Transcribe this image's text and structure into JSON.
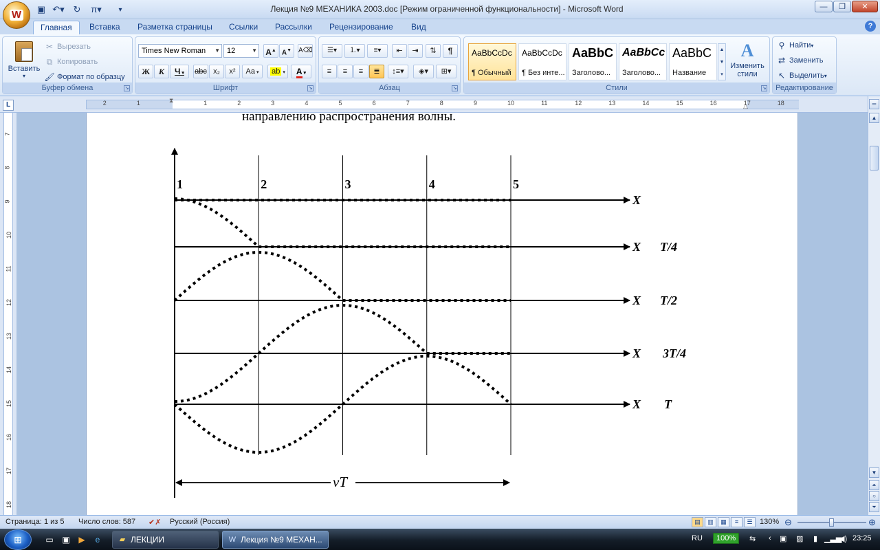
{
  "window": {
    "title": "Лекция №9 МЕХАНИКА 2003.doc [Режим ограниченной функциональности] - Microsoft Word",
    "office_button_letter": "W"
  },
  "tabs": [
    "Главная",
    "Вставка",
    "Разметка страницы",
    "Ссылки",
    "Рассылки",
    "Рецензирование",
    "Вид"
  ],
  "active_tab": "Главная",
  "ribbon": {
    "clipboard": {
      "label": "Буфер обмена",
      "paste": "Вставить",
      "cut": "Вырезать",
      "copy": "Копировать",
      "format_painter": "Формат по образцу"
    },
    "font": {
      "label": "Шрифт",
      "font_name": "Times New Roman",
      "font_size": "12",
      "bold": "Ж",
      "italic": "К",
      "underline": "Ч",
      "strike": "abc",
      "subscript": "x₂",
      "superscript": "x²",
      "change_case": "Aa",
      "grow": "A",
      "shrink": "A"
    },
    "paragraph": {
      "label": "Абзац"
    },
    "styles": {
      "label": "Стили",
      "items": [
        {
          "sample": "AaBbCcDc",
          "name": "¶ Обычный"
        },
        {
          "sample": "AaBbCcDc",
          "name": "¶ Без инте..."
        },
        {
          "sample": "AaBbC",
          "name": "Заголово..."
        },
        {
          "sample": "AaBbCc",
          "name": "Заголово..."
        },
        {
          "sample": "AaBbC",
          "name": "Название"
        }
      ],
      "selected_index": 0,
      "change_styles": "Изменить стили"
    },
    "editing": {
      "label": "Редактирование",
      "find": "Найти",
      "replace": "Заменить",
      "select": "Выделить"
    }
  },
  "ruler": {
    "h_left": [
      "2",
      "1"
    ],
    "h_right": [
      "1",
      "2",
      "3",
      "4",
      "5",
      "6",
      "7",
      "8",
      "9",
      "10",
      "11",
      "12",
      "13",
      "14",
      "15",
      "16",
      "17",
      "18"
    ],
    "v": [
      "7",
      "8",
      "9",
      "10",
      "11",
      "12",
      "13",
      "14",
      "15",
      "16",
      "17",
      "18"
    ]
  },
  "document": {
    "text_line": "направлению распространения волны.",
    "figure": {
      "column_labels": [
        "1",
        "2",
        "3",
        "4",
        "5"
      ],
      "row_axis_label": "X",
      "row_time_labels": [
        "",
        "T/4",
        "T/2",
        "3T/4",
        "T"
      ],
      "span_label": "vT"
    }
  },
  "status": {
    "page": "Страница: 1 из 5",
    "words": "Число слов: 587",
    "language": "Русский (Россия)",
    "zoom": "130%",
    "zoom_slider_level": 0.5
  },
  "taskbar": {
    "tasks": [
      {
        "label": "ЛЕКЦИИ",
        "active": false
      },
      {
        "label": "Лекция №9 МЕХАН...",
        "active": true
      }
    ],
    "lang": "RU",
    "battery": "100%",
    "clock": "23:25"
  }
}
